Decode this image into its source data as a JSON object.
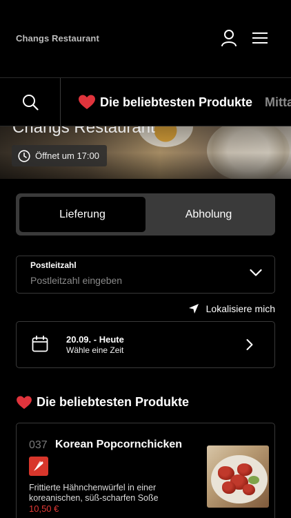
{
  "header": {
    "brand": "Changs Restaurant"
  },
  "category_nav": {
    "items": [
      {
        "label": "Die beliebtesten Produkte",
        "icon": "heart-icon",
        "active": true
      },
      {
        "label": "Mitta",
        "active": false
      }
    ]
  },
  "hero": {
    "title": "Changs Restaurant",
    "opening": "Öffnet um 17:00"
  },
  "delivery_toggle": {
    "options": [
      "Lieferung",
      "Abholung"
    ],
    "selected": "Lieferung"
  },
  "postal": {
    "label": "Postleitzahl",
    "placeholder": "Postleitzahl eingeben",
    "value": ""
  },
  "locate": {
    "label": "Lokalisiere mich"
  },
  "date_picker": {
    "date": "20.09. - Heute",
    "hint": "Wähle eine Zeit"
  },
  "section": {
    "title": "Die beliebtesten Produkte"
  },
  "product": {
    "number": "037",
    "name": "Korean Popcornchicken",
    "description": "Frittierte Hähnchenwürfel in einer koreanischen, süß-scharfen Soße",
    "price": "10,50 €",
    "badge_icon": "chili-icon"
  },
  "colors": {
    "background": "#000000",
    "price": "#e53935",
    "badge": "#d8362b",
    "heart": "#e0343c"
  }
}
